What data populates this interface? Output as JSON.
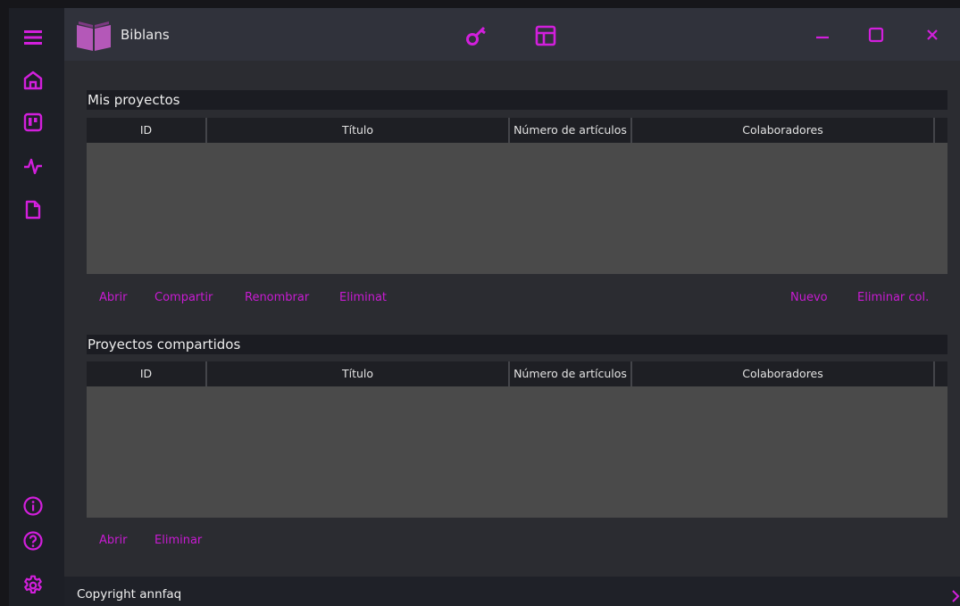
{
  "app": {
    "title": "Biblans"
  },
  "colors": {
    "accent": "#d21fdc",
    "header_dark": "#1b1c22",
    "grid_body": "#4a4a4a"
  },
  "sidebar": {
    "top_items": [
      {
        "icon": "hamburger-menu-icon"
      },
      {
        "icon": "home-icon"
      },
      {
        "icon": "board-icon"
      },
      {
        "icon": "activity-icon"
      },
      {
        "icon": "file-icon"
      }
    ],
    "bottom_items": [
      {
        "icon": "info-icon"
      },
      {
        "icon": "help-icon"
      },
      {
        "icon": "settings-gear-icon"
      }
    ]
  },
  "titlebar": {
    "icons": [
      "key-icon",
      "layout-icon"
    ],
    "window_controls": [
      "minimize-icon",
      "maximize-icon",
      "close-icon"
    ]
  },
  "my_projects": {
    "header": "Mis proyectos",
    "columns": [
      "ID",
      "Título",
      "Número de artículos",
      "Colaboradores"
    ],
    "rows": [],
    "actions_left": [
      "Abrir",
      "Compartir",
      "Renombrar",
      "Eliminat"
    ],
    "actions_right": [
      "Nuevo",
      "Eliminar col."
    ]
  },
  "shared_projects": {
    "header": "Proyectos compartidos",
    "columns": [
      "ID",
      "Título",
      "Número de artículos",
      "Colaboradores"
    ],
    "rows": [],
    "actions_left": [
      "Abrir",
      "Eliminar"
    ]
  },
  "footer": {
    "text": "Copyright annfaq"
  }
}
